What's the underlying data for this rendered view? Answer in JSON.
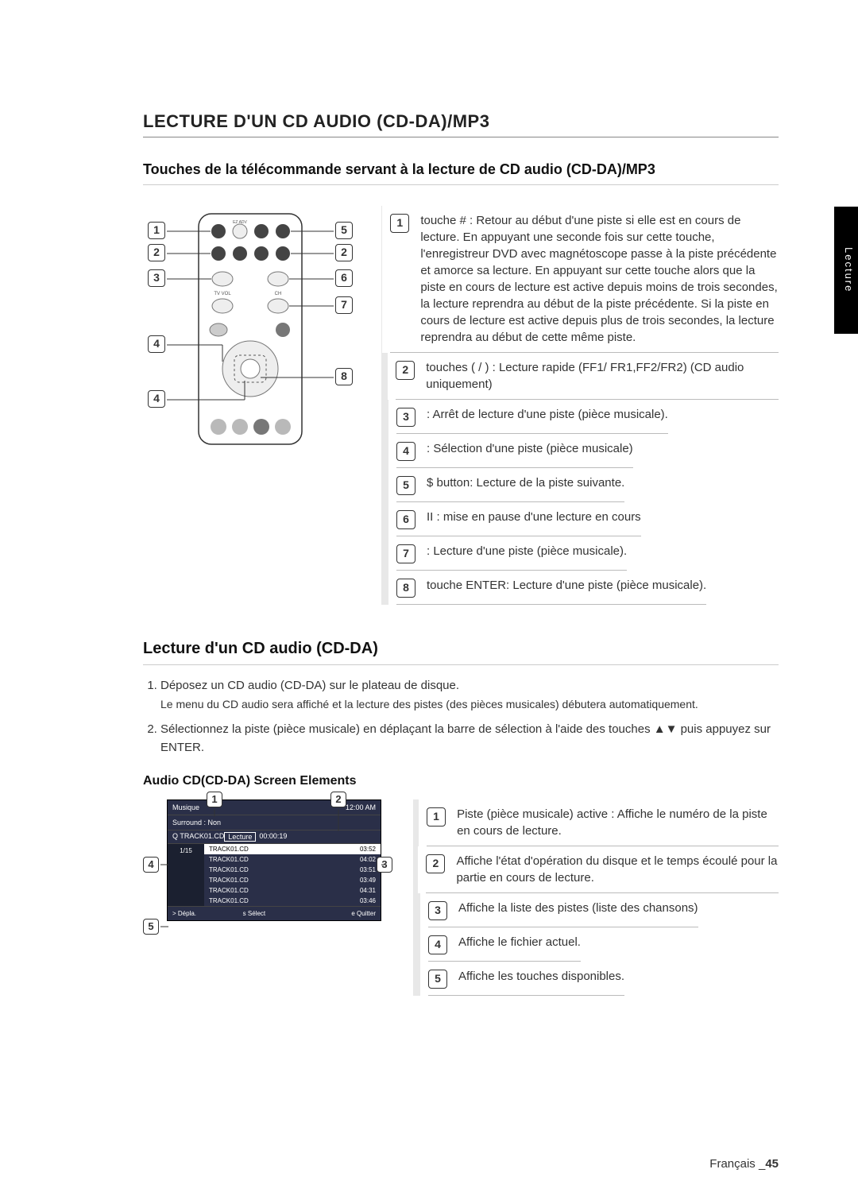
{
  "sideTab": "Lecture",
  "sectionTitle": "LECTURE D'UN CD AUDIO (CD-DA)/MP3",
  "subTitle": "Touches de la télécommande servant à la lecture de CD audio (CD-DA)/MP3",
  "remoteCallouts": {
    "c1": "1",
    "c2": "2",
    "c3": "3",
    "c4a": "4",
    "c4b": "4",
    "c5": "5",
    "c2r": "2",
    "c6": "6",
    "c7": "7",
    "c8": "8"
  },
  "remoteLabels": {
    "tvvol": "TV VOL",
    "ch": "CH",
    "ezAdv": "EZ ADV"
  },
  "descItems": [
    {
      "n": "1",
      "text": "touche #    : Retour au début d'une piste si elle est en cours de lecture. En appuyant une seconde fois sur cette touche, l'enregistreur DVD avec magnétoscope passe à la piste précédente et amorce sa lecture. En appuyant sur cette touche alors que la piste en cours de lecture est active depuis moins de trois secondes, la lecture reprendra au début de la piste précédente. Si la piste en cours de lecture est active depuis plus de trois secondes, la lecture reprendra au début de cette même piste."
    },
    {
      "n": "2",
      "text": "touches (    /    ) : Lecture rapide (FF1/ FR1,FF2/FR2) (CD audio uniquement)"
    },
    {
      "n": "3",
      "text": "   : Arrêt de lecture d'une piste (pièce musicale)."
    },
    {
      "n": "4",
      "text": "   : Sélection d'une piste (pièce musicale)"
    },
    {
      "n": "5",
      "text": "$    button: Lecture de la piste suivante."
    },
    {
      "n": "6",
      "text": "II : mise en pause d'une lecture en cours"
    },
    {
      "n": "7",
      "text": "   : Lecture d'une piste (pièce musicale)."
    },
    {
      "n": "8",
      "text": "touche ENTER: Lecture d'une piste (pièce musicale)."
    }
  ],
  "subTitle2": "Lecture d'un CD audio (CD-DA)",
  "steps": [
    {
      "main": "Déposez un CD audio (CD-DA) sur le plateau de disque.",
      "sub": "Le menu du CD audio sera affiché et la lecture des pistes (des pièces musicales) débutera automatiquement."
    },
    {
      "main": "Sélectionnez la piste (pièce musicale) en déplaçant la barre de sélection à l'aide des touches ▲▼ puis appuyez sur ENTER.",
      "sub": ""
    }
  ],
  "subTitle3": "Audio CD(CD-DA) Screen Elements",
  "osd": {
    "title": "Musique",
    "clock": "12:00 AM",
    "surround": "Surround : Non",
    "nowTrack": "Q TRACK01.CD",
    "state": "Lecture",
    "elapsed": "00:00:19",
    "folderCount": "1/15",
    "tracks": [
      {
        "name": "TRACK01.CD",
        "dur": "03:52"
      },
      {
        "name": "TRACK01.CD",
        "dur": "04:02"
      },
      {
        "name": "TRACK01.CD",
        "dur": "03:51"
      },
      {
        "name": "TRACK01.CD",
        "dur": "03:49"
      },
      {
        "name": "TRACK01.CD",
        "dur": "04:31"
      },
      {
        "name": "TRACK01.CD",
        "dur": "03:46"
      }
    ],
    "foot1": "> Dépla.",
    "foot2": "s Sélect",
    "foot3": "e Quitter"
  },
  "osdDesc": [
    {
      "n": "1",
      "text": "Piste (pièce musicale) active : Affiche le numéro de la piste en cours de lecture."
    },
    {
      "n": "2",
      "text": "Affiche l'état d'opération du disque et le temps écoulé pour la partie en cours de lecture."
    },
    {
      "n": "3",
      "text": "Affiche la liste des pistes (liste des chansons)"
    },
    {
      "n": "4",
      "text": "Affiche le fichier actuel."
    },
    {
      "n": "5",
      "text": "Affiche les touches disponibles."
    }
  ],
  "footer": {
    "lang": "Français _",
    "page": "45"
  }
}
